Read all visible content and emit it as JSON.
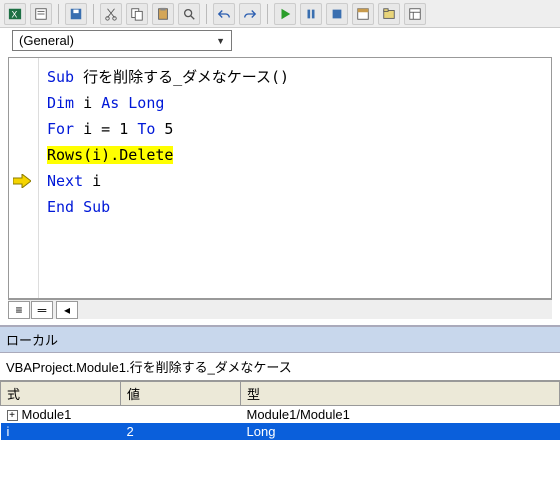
{
  "toolbar": {
    "icons": [
      "excel-icon",
      "form-icon",
      "save-icon",
      "cut-icon",
      "copy-icon",
      "paste-icon",
      "find-icon",
      "undo-icon",
      "redo-icon",
      "run-icon",
      "pause-icon",
      "stop-icon",
      "toggle-icon",
      "project-icon",
      "properties-icon"
    ]
  },
  "dropdown": {
    "value": "(General)"
  },
  "code": {
    "lines": [
      {
        "segments": [
          {
            "t": "Sub ",
            "kw": true
          },
          {
            "t": "行を削除する_ダメなケース()"
          }
        ]
      },
      {
        "segments": [
          {
            "t": "  "
          },
          {
            "t": "Dim ",
            "kw": true
          },
          {
            "t": "i "
          },
          {
            "t": "As Long",
            "kw": true
          }
        ]
      },
      {
        "segments": [
          {
            "t": " "
          }
        ]
      },
      {
        "segments": [
          {
            "t": "  "
          },
          {
            "t": "For ",
            "kw": true
          },
          {
            "t": "i = 1 "
          },
          {
            "t": "To ",
            "kw": true
          },
          {
            "t": "5"
          }
        ]
      },
      {
        "segments": [
          {
            "t": "    "
          },
          {
            "t": "Rows(i).Delete",
            "hl": true
          }
        ],
        "pointer": true
      },
      {
        "segments": [
          {
            "t": "  "
          },
          {
            "t": "Next ",
            "kw": true
          },
          {
            "t": "i"
          }
        ]
      },
      {
        "segments": [
          {
            "t": "End Sub",
            "kw": true
          }
        ]
      }
    ]
  },
  "locals": {
    "title": "ローカル",
    "path": "VBAProject.Module1.行を削除する_ダメなケース",
    "headers": {
      "expr": "式",
      "value": "値",
      "type": "型"
    },
    "rows": [
      {
        "expr": "Module1",
        "value": "",
        "type": "Module1/Module1",
        "expandable": true
      },
      {
        "expr": "  i",
        "value": "2",
        "type": "Long",
        "selected": true
      }
    ]
  }
}
